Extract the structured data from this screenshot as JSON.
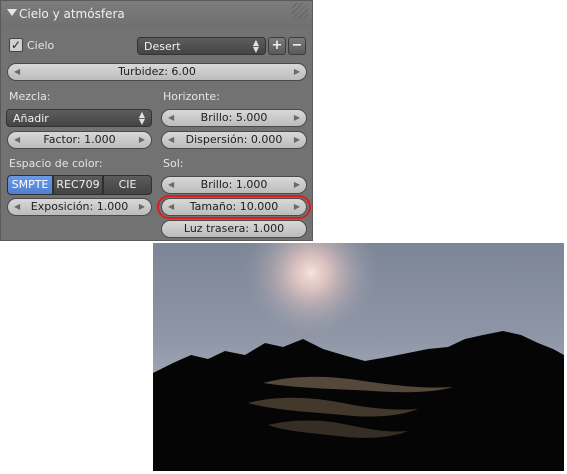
{
  "panel": {
    "title": "Cielo y atmósfera",
    "sky_checkbox_label": "Cielo",
    "sky_preset": "Desert",
    "turbidity": "Turbidez: 6.00",
    "mix_label": "Mezcla:",
    "mix_value": "Añadir",
    "factor": "Factor: 1.000",
    "color_space_label": "Espacio de color:",
    "color_space_options": [
      "SMPTE",
      "REC709",
      "CIE"
    ],
    "exposure": "Exposición: 1.000",
    "horizon_label": "Horizonte:",
    "horizon_brightness": "Brillo: 5.000",
    "horizon_spread": "Dispersión: 0.000",
    "sun_label": "Sol:",
    "sun_brightness": "Brillo: 1.000",
    "sun_size": "Tamaño: 10.000",
    "back_light": "Luz trasera: 1.000",
    "add_symbol": "+",
    "remove_symbol": "−"
  },
  "colors": {
    "panel_bg": "#727272",
    "active_segment": "#5a8ad8",
    "highlight": "#e01b1b",
    "sky_top": "#7d8696",
    "sun_glow": "#f1d6cb"
  }
}
